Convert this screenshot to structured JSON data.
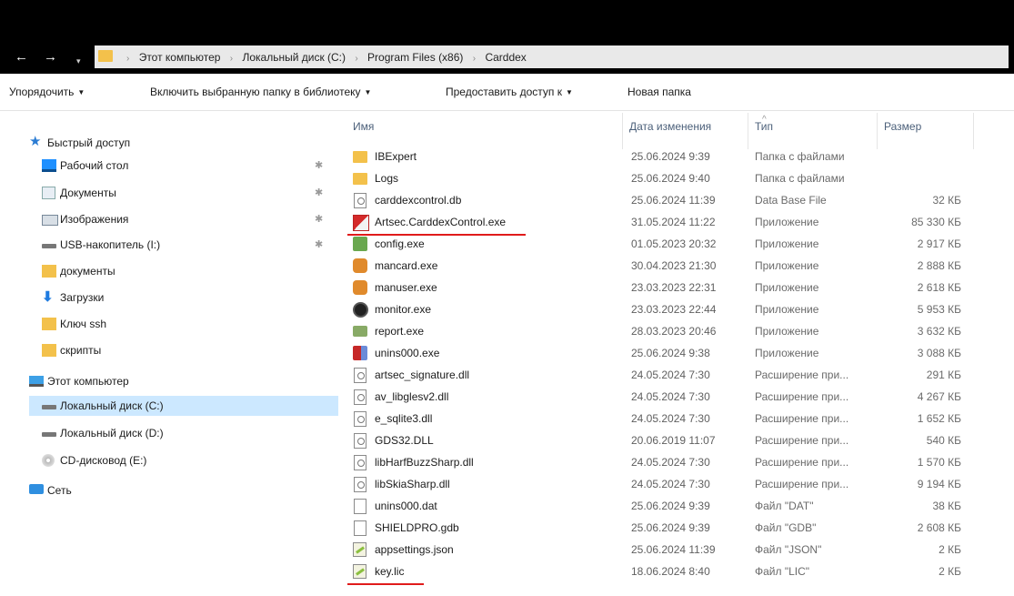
{
  "nav": {
    "back": "←",
    "forward": "→",
    "recent": "▾"
  },
  "breadcrumbs": [
    "Этот компьютер",
    "Локальный диск (C:)",
    "Program Files (x86)",
    "Carddex"
  ],
  "toolbar": {
    "organize": "Упорядочить",
    "include_library": "Включить выбранную папку в библиотеку",
    "share": "Предоставить доступ к",
    "new_folder": "Новая папка"
  },
  "sidebar": {
    "quick_access": "Быстрый доступ",
    "pinned": [
      {
        "label": "Рабочий стол",
        "icon": "desktop-icon"
      },
      {
        "label": "Документы",
        "icon": "documents-icon"
      },
      {
        "label": "Изображения",
        "icon": "pictures-icon"
      },
      {
        "label": "USB-накопитель (I:)",
        "icon": "drive-icon"
      }
    ],
    "recent": [
      {
        "label": "документы",
        "icon": "folder-icon"
      },
      {
        "label": "Загрузки",
        "icon": "downloads-icon"
      },
      {
        "label": "Ключ ssh",
        "icon": "folder-icon"
      },
      {
        "label": "скрипты",
        "icon": "folder-icon"
      }
    ],
    "this_pc": "Этот компьютер",
    "drives": [
      {
        "label": "Локальный диск (C:)",
        "icon": "drive-icon",
        "selected": true
      },
      {
        "label": "Локальный диск (D:)",
        "icon": "drive-icon"
      },
      {
        "label": "CD-дисковод (E:)",
        "icon": "cd-drive-icon"
      }
    ],
    "network": "Сеть"
  },
  "columns": {
    "name": "Имя",
    "date": "Дата изменения",
    "type": "Тип",
    "size": "Размер",
    "sort_indicator": "^"
  },
  "files": [
    {
      "name": "IBExpert",
      "date": "25.06.2024 9:39",
      "type": "Папка с файлами",
      "size": "",
      "icon": "folder-icon"
    },
    {
      "name": "Logs",
      "date": "25.06.2024 9:40",
      "type": "Папка с файлами",
      "size": "",
      "icon": "folder-icon"
    },
    {
      "name": "carddexcontrol.db",
      "date": "25.06.2024 11:39",
      "type": "Data Base File",
      "size": "32 КБ",
      "icon": "db-file-icon"
    },
    {
      "name": "Artsec.CarddexControl.exe",
      "date": "31.05.2024 11:22",
      "type": "Приложение",
      "size": "85 330 КБ",
      "icon": "artsec-app-icon"
    },
    {
      "name": "config.exe",
      "date": "01.05.2023 20:32",
      "type": "Приложение",
      "size": "2 917 КБ",
      "icon": "config-app-icon"
    },
    {
      "name": "mancard.exe",
      "date": "30.04.2023 21:30",
      "type": "Приложение",
      "size": "2 888 КБ",
      "icon": "mancard-app-icon"
    },
    {
      "name": "manuser.exe",
      "date": "23.03.2023 22:31",
      "type": "Приложение",
      "size": "2 618 КБ",
      "icon": "manuser-app-icon"
    },
    {
      "name": "monitor.exe",
      "date": "23.03.2023 22:44",
      "type": "Приложение",
      "size": "5 953 КБ",
      "icon": "monitor-app-icon"
    },
    {
      "name": "report.exe",
      "date": "28.03.2023 20:46",
      "type": "Приложение",
      "size": "3 632 КБ",
      "icon": "report-app-icon"
    },
    {
      "name": "unins000.exe",
      "date": "25.06.2024 9:38",
      "type": "Приложение",
      "size": "3 088 КБ",
      "icon": "uninstaller-icon"
    },
    {
      "name": "artsec_signature.dll",
      "date": "24.05.2024 7:30",
      "type": "Расширение при...",
      "size": "291 КБ",
      "icon": "dll-file-icon"
    },
    {
      "name": "av_libglesv2.dll",
      "date": "24.05.2024 7:30",
      "type": "Расширение при...",
      "size": "4 267 КБ",
      "icon": "dll-file-icon"
    },
    {
      "name": "e_sqlite3.dll",
      "date": "24.05.2024 7:30",
      "type": "Расширение при...",
      "size": "1 652 КБ",
      "icon": "dll-file-icon"
    },
    {
      "name": "GDS32.DLL",
      "date": "20.06.2019 11:07",
      "type": "Расширение при...",
      "size": "540 КБ",
      "icon": "dll-file-icon"
    },
    {
      "name": "libHarfBuzzSharp.dll",
      "date": "24.05.2024 7:30",
      "type": "Расширение при...",
      "size": "1 570 КБ",
      "icon": "dll-file-icon"
    },
    {
      "name": "libSkiaSharp.dll",
      "date": "24.05.2024 7:30",
      "type": "Расширение при...",
      "size": "9 194 КБ",
      "icon": "dll-file-icon"
    },
    {
      "name": "unins000.dat",
      "date": "25.06.2024 9:39",
      "type": "Файл \"DAT\"",
      "size": "38 КБ",
      "icon": "file-icon"
    },
    {
      "name": "SHIELDPRO.gdb",
      "date": "25.06.2024 9:39",
      "type": "Файл \"GDB\"",
      "size": "2 608 КБ",
      "icon": "file-icon"
    },
    {
      "name": "appsettings.json",
      "date": "25.06.2024 11:39",
      "type": "Файл \"JSON\"",
      "size": "2 КБ",
      "icon": "json-file-icon"
    },
    {
      "name": "key.lic",
      "date": "18.06.2024 8:40",
      "type": "Файл \"LIC\"",
      "size": "2 КБ",
      "icon": "license-file-icon"
    }
  ],
  "highlight_color": "#e01b1b"
}
